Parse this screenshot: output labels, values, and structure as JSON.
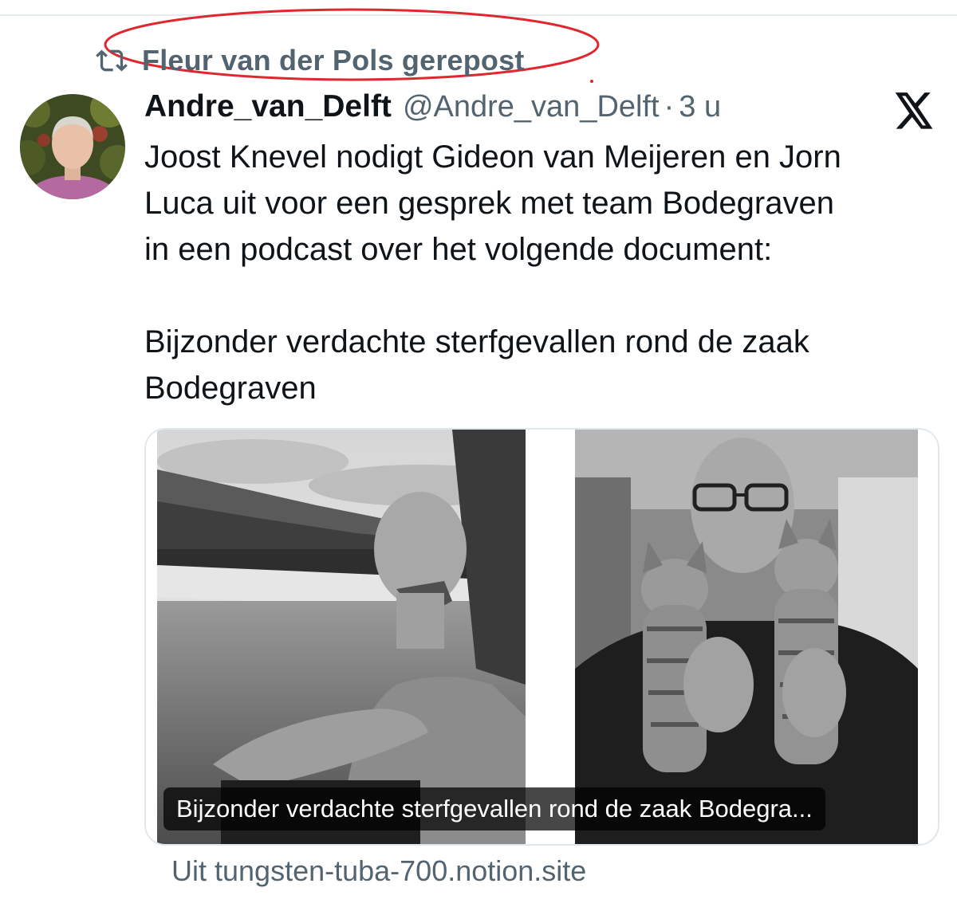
{
  "repost": {
    "icon": "repost-icon",
    "label": "Fleur van der Pols gerepost",
    "highlight_color": "#e0262f"
  },
  "tweet": {
    "avatar": "avatar",
    "display_name": "Andre_van_Delft",
    "handle": "@Andre_van_Delft",
    "separator": "·",
    "time": "3 u",
    "platform_icon": "x-logo-icon",
    "text_lines": [
      "Joost Knevel nodigt Gideon van Meijeren en Jorn",
      "Luca uit voor een gesprek met team Bodegraven",
      "in een podcast over het volgende document:",
      "",
      "Bijzonder verdachte sterfgevallen rond de zaak",
      "Bodegraven"
    ]
  },
  "card": {
    "caption": "Bijzonder verdachte sterfgevallen rond de zaak Bodegra...",
    "source": "Uit tungsten-tuba-700.notion.site"
  },
  "colors": {
    "text": "#0f1419",
    "secondary": "#536471",
    "border": "#e1e8ed"
  }
}
